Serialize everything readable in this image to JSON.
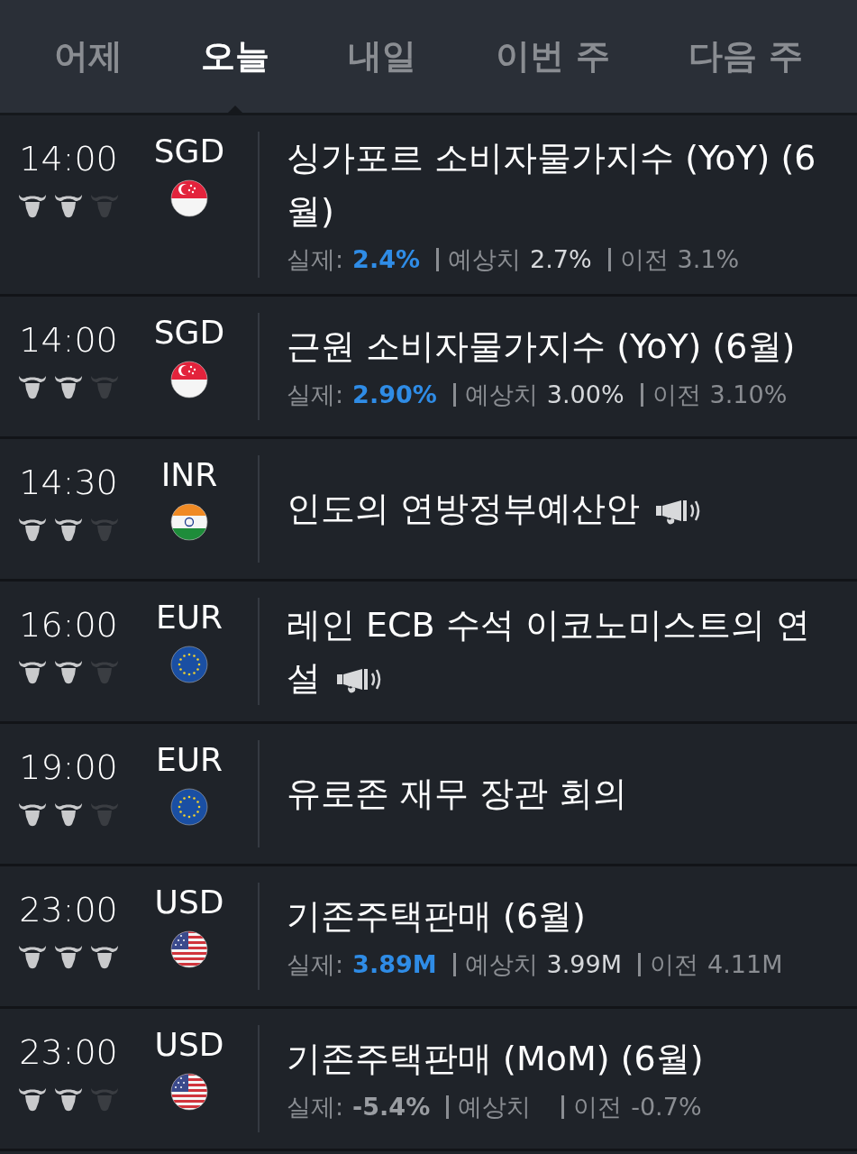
{
  "tabs": [
    {
      "label": "어제",
      "selected": false
    },
    {
      "label": "오늘",
      "selected": true
    },
    {
      "label": "내일",
      "selected": false
    },
    {
      "label": "이번 주",
      "selected": false
    },
    {
      "label": "다음 주",
      "selected": false
    }
  ],
  "events": [
    {
      "time": "14:00",
      "stars": 2,
      "currency": "SGD",
      "flag": {
        "kind": "sg"
      },
      "title": "싱가포르 소비자물가지수 (YoY) (6월)",
      "speech": false,
      "actual_label": "실제:",
      "actual": {
        "text": "2.4%",
        "color": "#2f8ce6"
      },
      "forecast_label": "예상치",
      "forecast": "2.7%",
      "previous_label": "이전",
      "previous": "3.1%"
    },
    {
      "time": "14:00",
      "stars": 2,
      "currency": "SGD",
      "flag": {
        "kind": "sg"
      },
      "title": "근원 소비자물가지수 (YoY) (6월)",
      "speech": false,
      "actual_label": "실제:",
      "actual": {
        "text": "2.90%",
        "color": "#2f8ce6"
      },
      "forecast_label": "예상치",
      "forecast": "3.00%",
      "previous_label": "이전",
      "previous": "3.10%"
    },
    {
      "time": "14:30",
      "stars": 2,
      "currency": "INR",
      "flag": {
        "kind": "in"
      },
      "title": "인도의 연방정부예산안",
      "speech": true
    },
    {
      "time": "16:00",
      "stars": 2,
      "currency": "EUR",
      "flag": {
        "kind": "eu"
      },
      "title": "레인 ECB 수석 이코노미스트의 연설",
      "speech": true
    },
    {
      "time": "19:00",
      "stars": 2,
      "currency": "EUR",
      "flag": {
        "kind": "eu"
      },
      "title": "유로존 재무 장관 회의",
      "speech": false
    },
    {
      "time": "23:00",
      "stars": 3,
      "currency": "USD",
      "flag": {
        "kind": "us"
      },
      "title": "기존주택판매 (6월)",
      "speech": false,
      "actual_label": "실제:",
      "actual": {
        "text": "3.89M",
        "color": "#2f8ce6"
      },
      "forecast_label": "예상치",
      "forecast": "3.99M",
      "previous_label": "이전",
      "previous": "4.11M"
    },
    {
      "time": "23:00",
      "stars": 2,
      "currency": "USD",
      "flag": {
        "kind": "us"
      },
      "title": "기존주택판매 (MoM) (6월)",
      "speech": false,
      "actual_label": "실제:",
      "actual": {
        "text": "-5.4%",
        "color": "#9a9da2"
      },
      "forecast_label": "예상치",
      "previous_label": "이전",
      "previous": "-0.7%"
    }
  ]
}
